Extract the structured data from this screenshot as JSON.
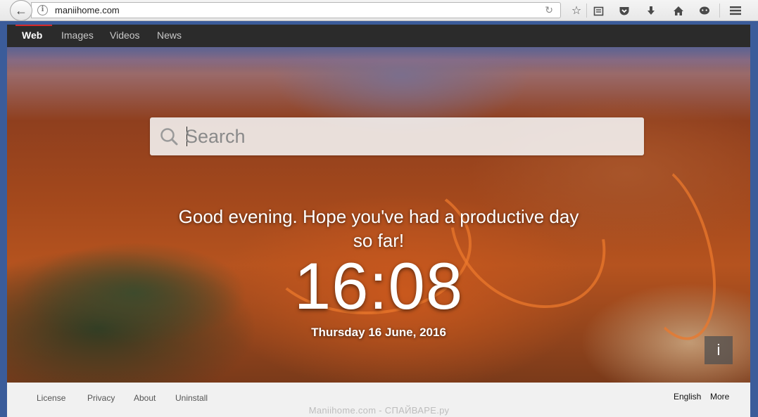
{
  "browser": {
    "url": "maniihome.com"
  },
  "nav": {
    "items": [
      {
        "label": "Web"
      },
      {
        "label": "Images"
      },
      {
        "label": "Videos"
      },
      {
        "label": "News"
      }
    ]
  },
  "search": {
    "placeholder": "Search"
  },
  "hero": {
    "greeting": "Good evening. Hope you've had a productive day so far!",
    "clock": "16:08",
    "date": "Thursday 16 June, 2016",
    "info_label": "i"
  },
  "footer": {
    "links": [
      "License",
      "Privacy",
      "About",
      "Uninstall"
    ],
    "language": "English",
    "more": "More"
  },
  "watermark": "Maniihome.com - СПАЙВАРЕ.ру",
  "colors": {
    "accent": "#d6292a",
    "nav_bg": "#2b2b2b"
  }
}
